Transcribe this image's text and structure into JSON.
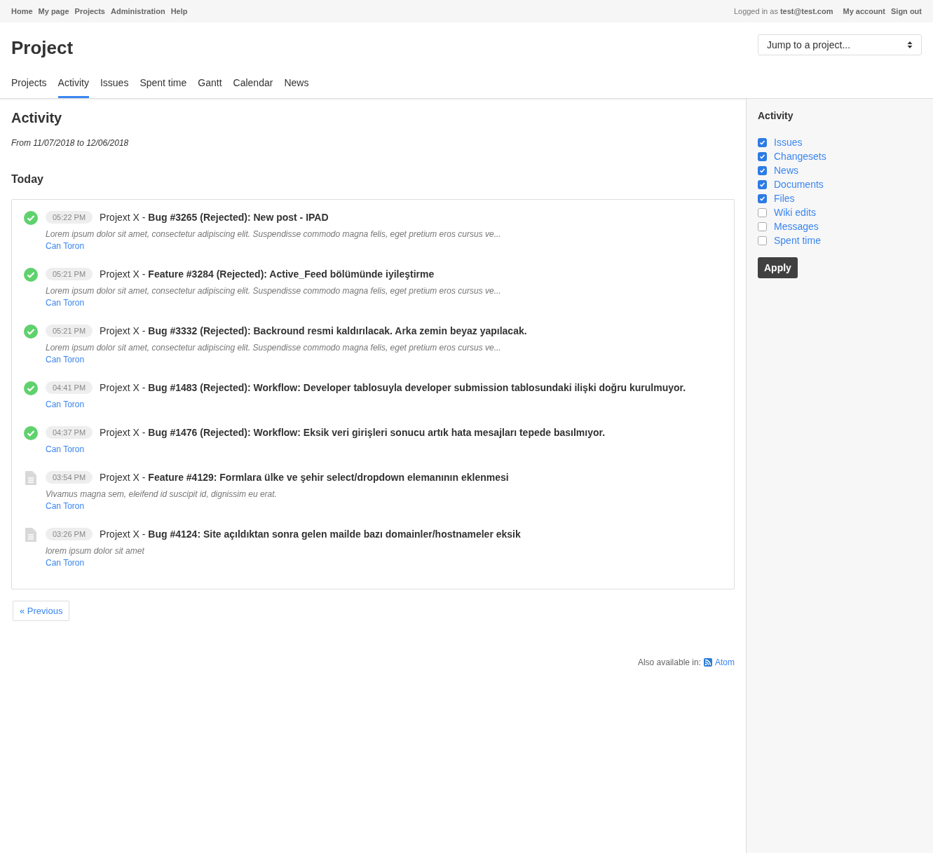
{
  "top_menu": {
    "items": [
      "Home",
      "My page",
      "Projects",
      "Administration",
      "Help"
    ],
    "logged_in": "Logged in as **test@test.com**",
    "account_links": [
      "My account",
      "Sign out"
    ]
  },
  "header": {
    "title": "Project",
    "jump": {
      "placeholder": "Jump to a project..."
    }
  },
  "tabs": [
    {
      "label": "Projects",
      "selected": false
    },
    {
      "label": "Activity",
      "selected": true
    },
    {
      "label": "Issues",
      "selected": false
    },
    {
      "label": "Spent time",
      "selected": false
    },
    {
      "label": "Gantt",
      "selected": false
    },
    {
      "label": "Calendar",
      "selected": false
    },
    {
      "label": "News",
      "selected": false
    }
  ],
  "content": {
    "title": "Activity",
    "date_range": "From 11/07/2018 to 12/06/2018",
    "day": "Today",
    "events": [
      {
        "kind": "closed",
        "time": "05:22 PM",
        "title": "Projext X - **Bug #3265 (Rejected): New post - IPAD**",
        "description": "Lorem ipsum dolor sit amet, consectetur adipiscing elit. Suspendisse commodo magna felis, eget pretium eros cursus ve...",
        "author": "Can Toron"
      },
      {
        "kind": "closed",
        "time": "05:21 PM",
        "title": "Projext X - **Feature #3284 (Rejected): Active_Feed bölümünde iyileştirme**",
        "description": "Lorem ipsum dolor sit amet, consectetur adipiscing elit. Suspendisse commodo magna felis, eget pretium eros cursus ve...",
        "author": "Can Toron"
      },
      {
        "kind": "closed",
        "time": "05:21 PM",
        "title": "Projext X - **Bug #3332 (Rejected): Backround resmi kaldırılacak. Arka zemin beyaz yapılacak.**",
        "description": "Lorem ipsum dolor sit amet, consectetur adipiscing elit. Suspendisse commodo magna felis, eget pretium eros cursus ve...",
        "author": "Can Toron"
      },
      {
        "kind": "closed",
        "time": "04:41 PM",
        "title": "Projext X - **Bug #1483 (Rejected): Workflow: Developer tablosuyla developer submission tablosundaki ilişki doğru kurulmuyor.**",
        "author": "Can Toron"
      },
      {
        "kind": "closed",
        "time": "04:37 PM",
        "title": "Projext X - **Bug #1476 (Rejected): Workflow: Eksik veri girişleri sonucu artık hata mesajları tepede basılmıyor.**",
        "author": "Can Toron"
      },
      {
        "kind": "issue",
        "time": "03:54 PM",
        "title": "Projext X - **Feature #4129: Formlara ülke ve şehir select/dropdown elemanının eklenmesi**",
        "description": "Vivamus magna sem, eleifend id suscipit id, dignissim eu erat.",
        "author": "Can Toron"
      },
      {
        "kind": "issue",
        "time": "03:26 PM",
        "title": "Projext X - **Bug #4124: Site açıldıktan sonra gelen mailde bazı domainler/hostnameler eksik**",
        "description": "lorem ipsum dolor sit amet",
        "author": "Can Toron"
      }
    ],
    "previous": "« Previous",
    "also_available": "Also available in:",
    "atom": "Atom"
  },
  "sidebar": {
    "title": "Activity",
    "filters": [
      {
        "label": "Issues",
        "checked": true
      },
      {
        "label": "Changesets",
        "checked": true
      },
      {
        "label": "News",
        "checked": true
      },
      {
        "label": "Documents",
        "checked": true
      },
      {
        "label": "Files",
        "checked": true
      },
      {
        "label": "Wiki edits",
        "checked": false
      },
      {
        "label": "Messages",
        "checked": false
      },
      {
        "label": "Spent time",
        "checked": false
      }
    ],
    "apply": "Apply"
  }
}
